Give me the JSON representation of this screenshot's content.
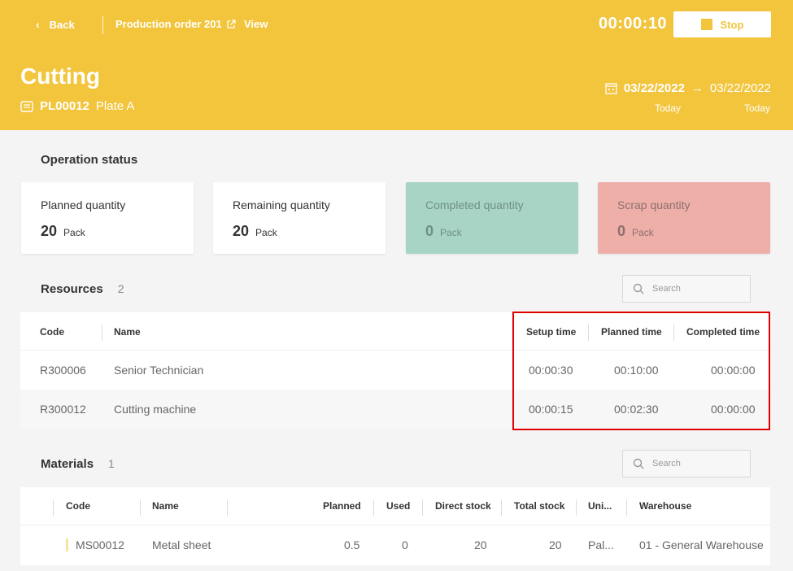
{
  "header": {
    "back_label": "Back",
    "order_label": "Production order 201",
    "view_label": "View",
    "timer": "00:00:10",
    "stop_label": "Stop",
    "title": "Cutting",
    "product_code": "PL00012",
    "product_name": "Plate A",
    "start_date": "03/22/2022",
    "end_date": "03/22/2022",
    "start_sub": "Today",
    "end_sub": "Today",
    "accent": "#f2c53d"
  },
  "operation_status": {
    "title": "Operation status",
    "cards": [
      {
        "label": "Planned quantity",
        "value": "20",
        "unit": "Pack"
      },
      {
        "label": "Remaining quantity",
        "value": "20",
        "unit": "Pack"
      },
      {
        "label": "Completed quantity",
        "value": "0",
        "unit": "Pack"
      },
      {
        "label": "Scrap quantity",
        "value": "0",
        "unit": "Pack"
      }
    ]
  },
  "resources": {
    "title": "Resources",
    "count": "2",
    "search_placeholder": "Search",
    "columns": {
      "code": "Code",
      "name": "Name",
      "setup": "Setup time",
      "planned": "Planned time",
      "completed": "Completed time"
    },
    "rows": [
      {
        "code": "R300006",
        "name": "Senior Technician",
        "setup": "00:00:30",
        "planned": "00:10:00",
        "completed": "00:00:00"
      },
      {
        "code": "R300012",
        "name": "Cutting machine",
        "setup": "00:00:15",
        "planned": "00:02:30",
        "completed": "00:00:00"
      }
    ]
  },
  "materials": {
    "title": "Materials",
    "count": "1",
    "search_placeholder": "Search",
    "columns": {
      "code": "Code",
      "name": "Name",
      "planned": "Planned",
      "used": "Used",
      "direct": "Direct stock",
      "total": "Total stock",
      "unit": "Uni...",
      "warehouse": "Warehouse"
    },
    "rows": [
      {
        "code": "MS00012",
        "name": "Metal sheet",
        "planned": "0.5",
        "used": "0",
        "direct": "20",
        "total": "20",
        "unit": "Pal...",
        "warehouse": "01 - General Warehouse"
      }
    ]
  }
}
